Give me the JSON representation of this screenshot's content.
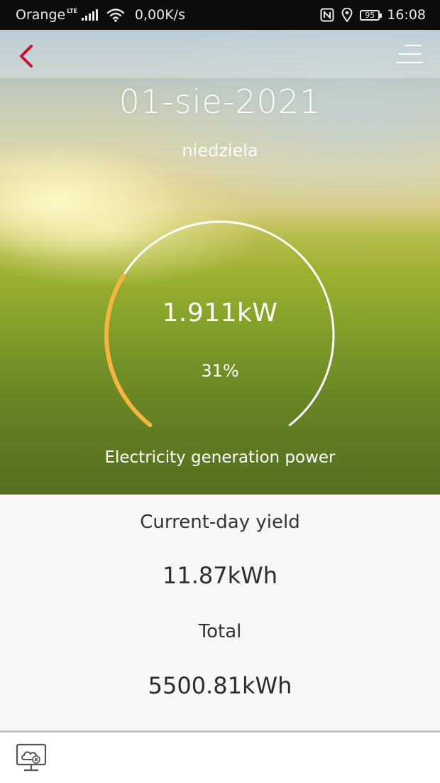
{
  "status_bar": {
    "carrier": "Orange",
    "network_type": "LTE",
    "speed": "0,00K/s",
    "battery": "95",
    "time": "16:08"
  },
  "header": {
    "date": "01-sie-2021",
    "weekday": "niedziela"
  },
  "gauge": {
    "power_value": "1.911kW",
    "percent_text": "31%",
    "percent": 31,
    "label": "Electricity generation power",
    "track_color": "#ffffff",
    "fill_color": "#f4b63f"
  },
  "stats": {
    "day_yield_label": "Current-day yield",
    "day_yield_value": "11.87kWh",
    "total_label": "Total",
    "total_value": "5500.81kWh"
  },
  "colors": {
    "accent": "#c8102e"
  }
}
